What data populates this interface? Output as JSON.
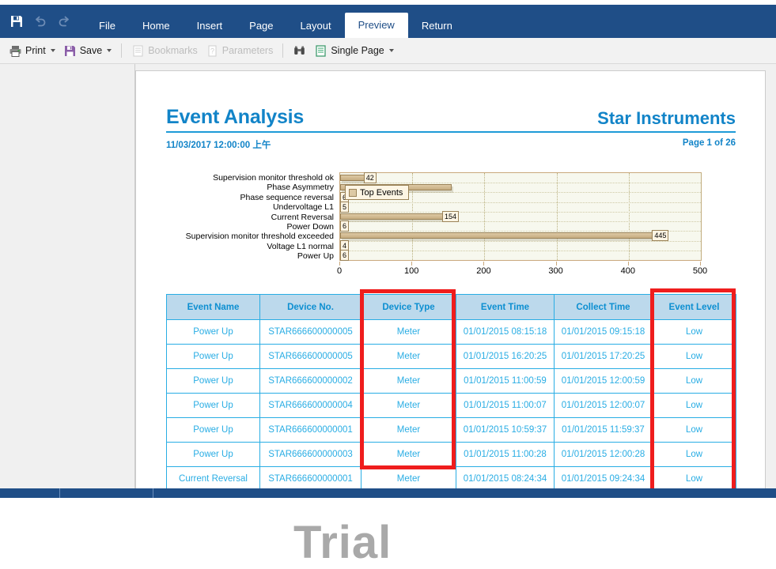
{
  "titlebar": {
    "icons": [
      {
        "name": "save-icon",
        "label": "Save"
      },
      {
        "name": "undo-icon",
        "label": "Undo"
      },
      {
        "name": "redo-icon",
        "label": "Redo"
      }
    ],
    "menu": [
      {
        "label": "File",
        "active": false
      },
      {
        "label": "Home",
        "active": false
      },
      {
        "label": "Insert",
        "active": false
      },
      {
        "label": "Page",
        "active": false
      },
      {
        "label": "Layout",
        "active": false
      },
      {
        "label": "Preview",
        "active": true
      },
      {
        "label": "Return",
        "active": false
      }
    ]
  },
  "toolbar": {
    "print": "Print",
    "save": "Save",
    "bookmarks": "Bookmarks",
    "parameters": "Parameters",
    "single_page": "Single Page"
  },
  "report": {
    "title": "Event Analysis",
    "company": "Star Instruments",
    "date": "11/03/2017 12:00:00 上午",
    "page_info": "Page 1 of 26"
  },
  "chart_data": {
    "type": "bar",
    "orientation": "horizontal",
    "title": "",
    "legend": [
      "Top Events"
    ],
    "legend_position": "overlay-top-left",
    "xlabel": "",
    "ylabel": "",
    "xlim": [
      0,
      500
    ],
    "xticks": [
      0,
      100,
      200,
      300,
      400,
      500
    ],
    "grid": true,
    "categories": [
      "Supervision monitor threshold ok",
      "Phase Asymmetry",
      "Phase sequence reversal",
      "Undervoltage L1",
      "Current Reversal",
      "Power Down",
      "Supervision monitor threshold exceeded",
      "Voltage L1 normal",
      "Power Up"
    ],
    "values": [
      42,
      155,
      6,
      5,
      154,
      6,
      445,
      4,
      6
    ],
    "value_labels": [
      "42",
      "",
      "6",
      "5",
      "154",
      "6",
      "445",
      "4",
      "6"
    ],
    "series": [
      {
        "name": "Top Events",
        "values": [
          42,
          155,
          6,
          5,
          154,
          6,
          445,
          4,
          6
        ]
      }
    ],
    "bar_color": "#ddc9a4",
    "plot_background": "#f7f8ee"
  },
  "table": {
    "columns": [
      "Event Name",
      "Device No.",
      "Device Type",
      "Event Time",
      "Collect Time",
      "Event Level"
    ],
    "rows": [
      [
        "Power Up",
        "STAR666600000005",
        "Meter",
        "01/01/2015 08:15:18",
        "01/01/2015 09:15:18",
        "Low"
      ],
      [
        "Power Up",
        "STAR666600000005",
        "Meter",
        "01/01/2015 16:20:25",
        "01/01/2015 17:20:25",
        "Low"
      ],
      [
        "Power Up",
        "STAR666600000002",
        "Meter",
        "01/01/2015 11:00:59",
        "01/01/2015 12:00:59",
        "Low"
      ],
      [
        "Power Up",
        "STAR666600000004",
        "Meter",
        "01/01/2015 11:00:07",
        "01/01/2015 12:00:07",
        "Low"
      ],
      [
        "Power Up",
        "STAR666600000001",
        "Meter",
        "01/01/2015 10:59:37",
        "01/01/2015 11:59:37",
        "Low"
      ],
      [
        "Power Up",
        "STAR666600000003",
        "Meter",
        "01/01/2015 11:00:28",
        "01/01/2015 12:00:28",
        "Low"
      ],
      [
        "Current Reversal",
        "STAR666600000001",
        "Meter",
        "01/01/2015 08:24:34",
        "01/01/2015 09:24:34",
        "Low"
      ]
    ]
  },
  "watermark": {
    "text": "Trial"
  },
  "colors": {
    "ribbon": "#1f4e87",
    "accent_blue": "#1284c8",
    "table_border": "#29ade4",
    "table_header_bg": "#bcd9ec",
    "annotation_red": "#ef1d1d"
  }
}
